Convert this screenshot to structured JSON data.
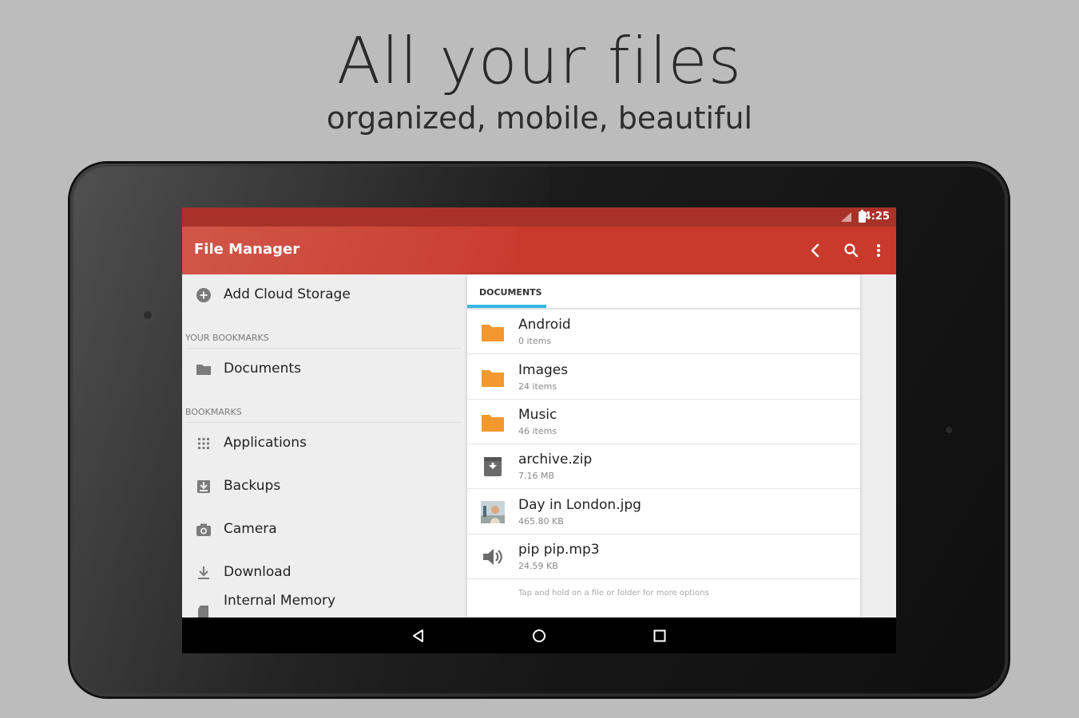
{
  "promo": {
    "headline": "All your files",
    "subline": "organized, mobile, beautiful"
  },
  "status_bar": {
    "time": "4:25"
  },
  "app_bar": {
    "title": "File Manager",
    "actions": [
      "back-icon",
      "search-icon",
      "more-vert-icon"
    ]
  },
  "sidebar": {
    "add_cloud": "Add Cloud Storage",
    "your_bookmarks_header": "YOUR BOOKMARKS",
    "your_bookmarks": [
      {
        "label": "Documents",
        "icon": "folder-icon"
      }
    ],
    "bookmarks_header": "BOOKMARKS",
    "bookmarks": [
      {
        "label": "Applications",
        "icon": "grid-icon"
      },
      {
        "label": "Backups",
        "icon": "backup-icon"
      },
      {
        "label": "Camera",
        "icon": "camera-icon"
      },
      {
        "label": "Download",
        "icon": "download-icon"
      },
      {
        "label": "Internal Memory",
        "icon": "sd-card-icon"
      }
    ]
  },
  "panel": {
    "tab": "DOCUMENTS",
    "files": [
      {
        "name": "Android",
        "meta": "0 items",
        "icon": "folder-icon"
      },
      {
        "name": "Images",
        "meta": "24 items",
        "icon": "folder-icon"
      },
      {
        "name": "Music",
        "meta": "46 items",
        "icon": "folder-icon"
      },
      {
        "name": "archive.zip",
        "meta": "7.16 MB",
        "icon": "archive-icon"
      },
      {
        "name": "Day in London.jpg",
        "meta": "465.80 KB",
        "icon": "image-thumbnail"
      },
      {
        "name": "pip pip.mp3",
        "meta": "24.59 KB",
        "icon": "audio-icon"
      }
    ],
    "hint": "Tap and hold on a file or folder for more options"
  },
  "colors": {
    "primary": "#c93a2c",
    "status_bar": "#a83228",
    "accent": "#33b5e5",
    "folder": "#f2982e"
  }
}
